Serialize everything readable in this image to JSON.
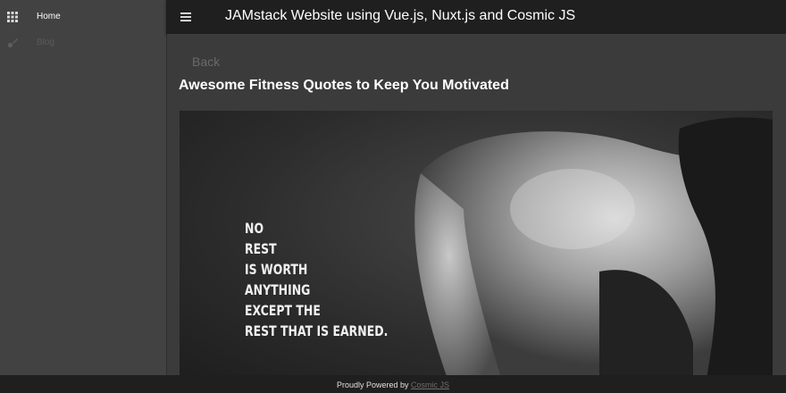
{
  "sidebar": {
    "items": [
      {
        "label": "Home",
        "icon": "apps-grid-icon"
      },
      {
        "label": "Blog",
        "icon": "brush-icon"
      }
    ]
  },
  "toolbar": {
    "title": "JAMstack Website using Vue.js, Nuxt.js and Cosmic JS",
    "menu_icon": "menu-icon"
  },
  "post": {
    "back_label": "Back",
    "title": "Awesome Fitness Quotes to Keep You Motivated",
    "image_quote_lines": [
      "NO",
      "REST",
      "IS WORTH",
      "ANYTHING",
      "EXCEPT THE",
      "REST THAT IS EARNED."
    ]
  },
  "footer": {
    "text": "Proudly Powered by ",
    "link_label": "Cosmic JS"
  },
  "colors": {
    "sidebar_bg": "#424242",
    "toolbar_bg": "#1f1f1f",
    "main_bg": "#3b3b3b",
    "text": "#ffffff",
    "muted": "#6a6a6a"
  }
}
